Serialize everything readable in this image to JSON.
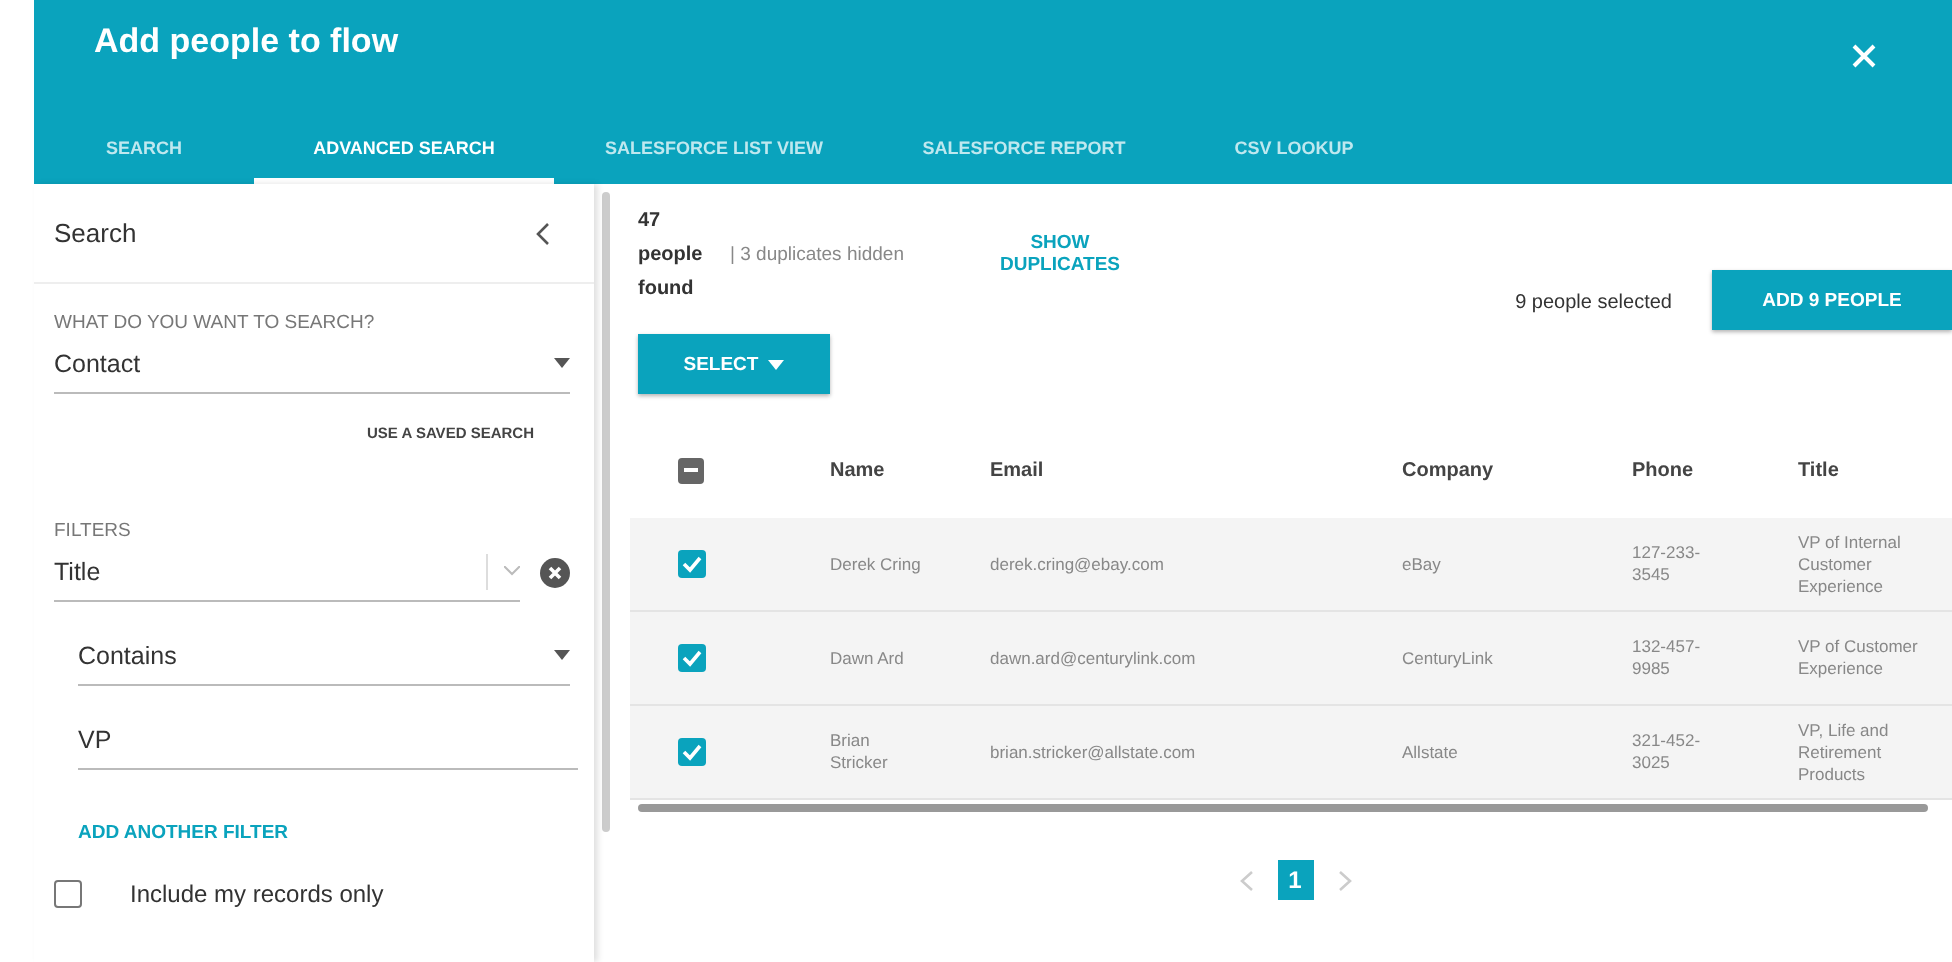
{
  "window": {
    "title": "Add people to flow"
  },
  "tabs": [
    {
      "label": "SEARCH",
      "selected": false
    },
    {
      "label": "ADVANCED SEARCH",
      "selected": true
    },
    {
      "label": "SALESFORCE LIST VIEW",
      "selected": false
    },
    {
      "label": "SALESFORCE REPORT",
      "selected": false
    },
    {
      "label": "CSV LOOKUP",
      "selected": false
    }
  ],
  "sidebar": {
    "title": "Search",
    "question_label": "WHAT DO YOU WANT TO SEARCH?",
    "object_select": "Contact",
    "saved_search_link": "USE A SAVED SEARCH",
    "filters_label": "FILTERS",
    "filter_field": "Title",
    "filter_operator": "Contains",
    "filter_value": "VP",
    "add_filter_link": "ADD ANOTHER FILTER",
    "include_mine": {
      "label": "Include my records only",
      "checked": false
    }
  },
  "results": {
    "count": "47",
    "count_label": "people",
    "count_suffix": "found",
    "duplicates_note": "| 3 duplicates hidden",
    "show_duplicates": "SHOW DUPLICATES",
    "selected_note": "9 people selected",
    "add_button": "ADD 9 PEOPLE",
    "select_button": "SELECT"
  },
  "table": {
    "header_indeterminate": true,
    "columns": [
      "Name",
      "Email",
      "Company",
      "Phone",
      "Title"
    ],
    "rows": [
      {
        "checked": true,
        "cells": [
          "Derek Cring",
          "derek.cring@ebay.com",
          "eBay",
          "127-233-3545",
          "VP of Internal Customer Experience"
        ]
      },
      {
        "checked": true,
        "cells": [
          "Dawn Ard",
          "dawn.ard@centurylink.com",
          "CenturyLink",
          "132-457-9985",
          "VP of Customer Experience"
        ]
      },
      {
        "checked": true,
        "cells": [
          "Brian Stricker",
          "brian.stricker@allstate.com",
          "Allstate",
          "321-452-3025",
          "VP, Life and Retirement Products"
        ]
      }
    ]
  },
  "pagination": {
    "pages": [
      {
        "label": "1",
        "selected": true
      }
    ]
  }
}
